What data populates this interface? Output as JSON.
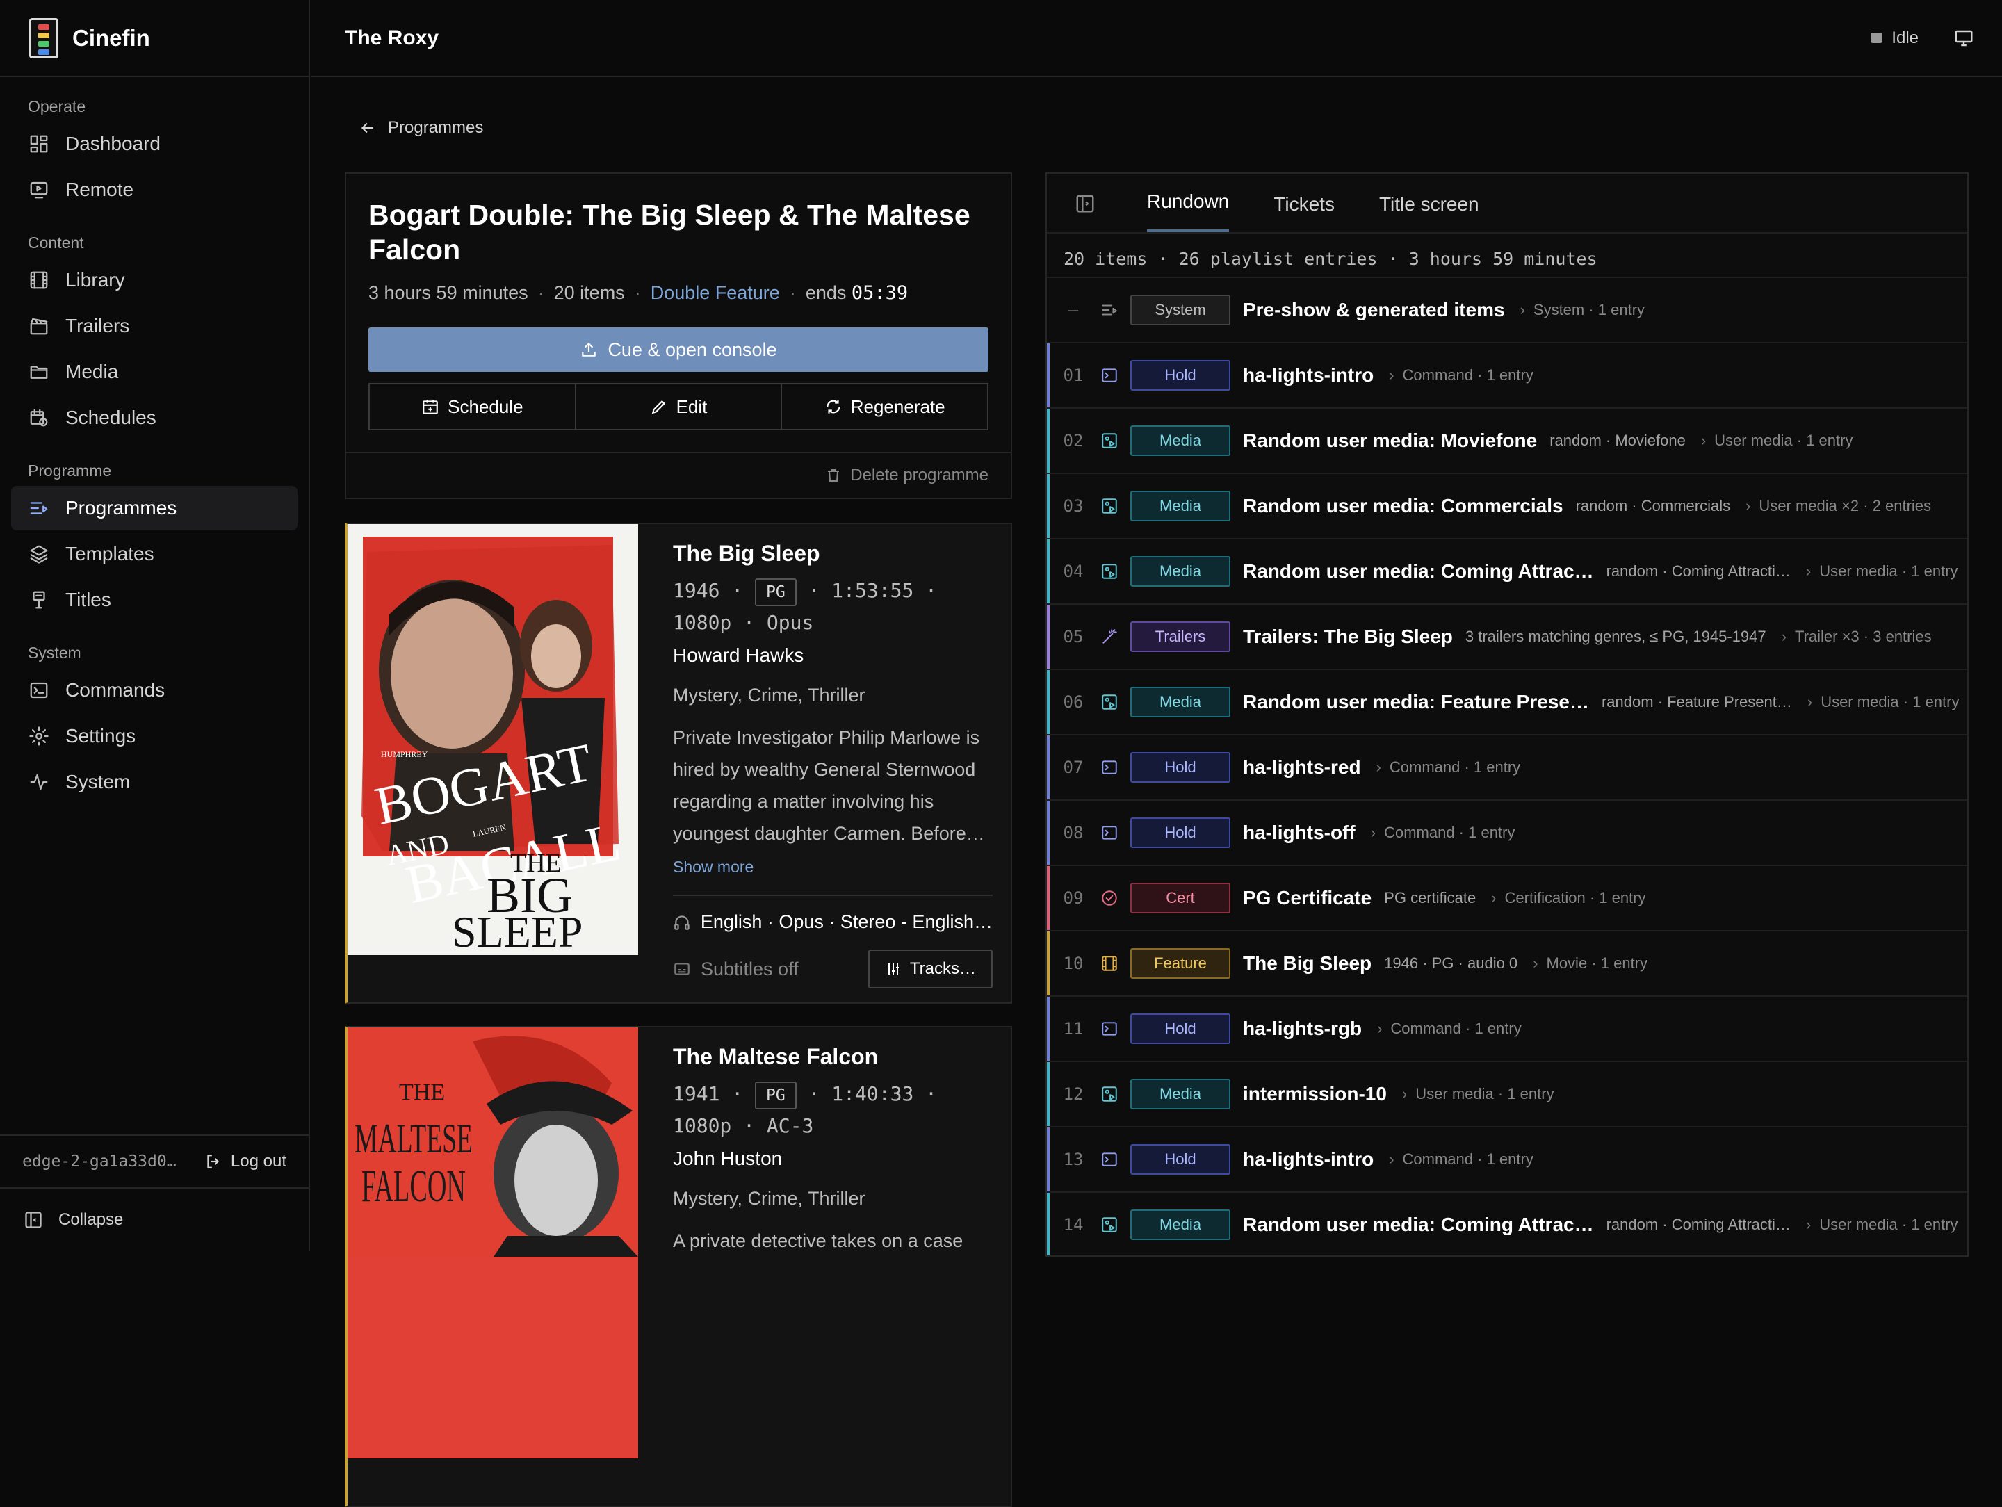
{
  "app": {
    "name": "Cinefin",
    "venue": "The Roxy",
    "status": "Idle"
  },
  "sidebar": {
    "sections": [
      {
        "label": "Operate",
        "items": [
          {
            "label": "Dashboard",
            "icon": "dashboard-icon"
          },
          {
            "label": "Remote",
            "icon": "remote-icon"
          }
        ]
      },
      {
        "label": "Content",
        "items": [
          {
            "label": "Library",
            "icon": "film-icon"
          },
          {
            "label": "Trailers",
            "icon": "clapper-icon"
          },
          {
            "label": "Media",
            "icon": "folder-icon"
          },
          {
            "label": "Schedules",
            "icon": "calendar-clock-icon"
          }
        ]
      },
      {
        "label": "Programme",
        "items": [
          {
            "label": "Programmes",
            "icon": "programmes-icon",
            "active": true
          },
          {
            "label": "Templates",
            "icon": "layers-icon"
          },
          {
            "label": "Titles",
            "icon": "titles-icon"
          }
        ]
      },
      {
        "label": "System",
        "items": [
          {
            "label": "Commands",
            "icon": "terminal-icon"
          },
          {
            "label": "Settings",
            "icon": "gear-icon"
          },
          {
            "label": "System",
            "icon": "activity-icon"
          }
        ]
      }
    ],
    "user_id": "edge-2-ga1a33d0…",
    "logout_label": "Log out",
    "collapse_label": "Collapse"
  },
  "breadcrumb": {
    "label": "Programmes"
  },
  "programme": {
    "title": "Bogart Double: The Big Sleep & The Maltese Falcon",
    "duration": "3 hours 59 minutes",
    "items": "20 items",
    "template": "Double Feature",
    "ends_label": "ends",
    "ends_time": "05:39",
    "cue_label": "Cue & open console",
    "schedule_label": "Schedule",
    "edit_label": "Edit",
    "regenerate_label": "Regenerate",
    "delete_label": "Delete programme"
  },
  "films": [
    {
      "title": "The Big Sleep",
      "year": "1946",
      "rating": "PG",
      "runtime": "1:53:55",
      "resolution": "1080p",
      "audio_codec": "Opus",
      "director": "Howard Hawks",
      "genres": "Mystery, Crime, Thriller",
      "synopsis": "Private Investigator Philip Marlowe is hired by wealthy General Sternwood regarding a matter involving his youngest daughter Carmen. Before…",
      "show_more": "Show more",
      "audio": "English · Opus · Stereo - English…",
      "subtitles": "Subtitles off",
      "tracks_label": "Tracks…",
      "poster_text": {
        "top": "HUMPHREY",
        "a": "BOGART",
        "and": "AND",
        "b": "BACALL",
        "lauren": "LAUREN",
        "the": "THE",
        "big": "BIG",
        "sleep": "SLEEP"
      }
    },
    {
      "title": "The Maltese Falcon",
      "year": "1941",
      "rating": "PG",
      "runtime": "1:40:33",
      "resolution": "1080p",
      "audio_codec": "AC-3",
      "director": "John Huston",
      "genres": "Mystery, Crime, Thriller",
      "synopsis": "A private detective takes on a case",
      "poster_text": {
        "the": "THE",
        "maltese": "MALTESE",
        "falcon": "FALCON"
      }
    }
  ],
  "rundown": {
    "tabs": [
      "Rundown",
      "Tickets",
      "Title screen"
    ],
    "summary": "20 items · 26 playlist entries · 3 hours 59 minutes",
    "rows": [
      {
        "num": "–",
        "type": "System",
        "name": "Pre-show & generated items",
        "sub": "",
        "kind": "System · 1 entry"
      },
      {
        "num": "01",
        "type": "Hold",
        "name": "ha-lights-intro",
        "sub": "",
        "kind": "Command · 1 entry"
      },
      {
        "num": "02",
        "type": "Media",
        "name": "Random user media: Moviefone",
        "sub": "random · Moviefone",
        "kind": "User media · 1 entry"
      },
      {
        "num": "03",
        "type": "Media",
        "name": "Random user media: Commercials",
        "sub": "random · Commercials",
        "kind": "User media ×2 · 2 entries"
      },
      {
        "num": "04",
        "type": "Media",
        "name": "Random user media: Coming Attrac…",
        "sub": "random · Coming Attracti…",
        "kind": "User media · 1 entry"
      },
      {
        "num": "05",
        "type": "Trailers",
        "name": "Trailers: The Big Sleep",
        "sub": "3 trailers matching genres, ≤ PG, 1945-1947",
        "kind": "Trailer ×3 · 3 entries"
      },
      {
        "num": "06",
        "type": "Media",
        "name": "Random user media: Feature Prese…",
        "sub": "random · Feature Present…",
        "kind": "User media · 1 entry"
      },
      {
        "num": "07",
        "type": "Hold",
        "name": "ha-lights-red",
        "sub": "",
        "kind": "Command · 1 entry"
      },
      {
        "num": "08",
        "type": "Hold",
        "name": "ha-lights-off",
        "sub": "",
        "kind": "Command · 1 entry"
      },
      {
        "num": "09",
        "type": "Cert",
        "name": "PG Certificate",
        "sub": "PG certificate",
        "kind": "Certification · 1 entry"
      },
      {
        "num": "10",
        "type": "Feature",
        "name": "The Big Sleep",
        "sub": "1946 · PG · audio 0",
        "kind": "Movie · 1 entry"
      },
      {
        "num": "11",
        "type": "Hold",
        "name": "ha-lights-rgb",
        "sub": "",
        "kind": "Command · 1 entry"
      },
      {
        "num": "12",
        "type": "Media",
        "name": "intermission-10",
        "sub": "",
        "kind": "User media · 1 entry"
      },
      {
        "num": "13",
        "type": "Hold",
        "name": "ha-lights-intro",
        "sub": "",
        "kind": "Command · 1 entry"
      },
      {
        "num": "14",
        "type": "Media",
        "name": "Random user media: Coming Attrac…",
        "sub": "random · Coming Attracti…",
        "kind": "User media · 1 entry"
      }
    ]
  },
  "colors": {
    "accent": "#6f8fba",
    "link": "#7ea6d8",
    "feature": "#c9a23a",
    "media": "#3fb6c8",
    "hold": "#6f7fd8",
    "trailers": "#9c7fe0",
    "cert": "#e0607a"
  }
}
